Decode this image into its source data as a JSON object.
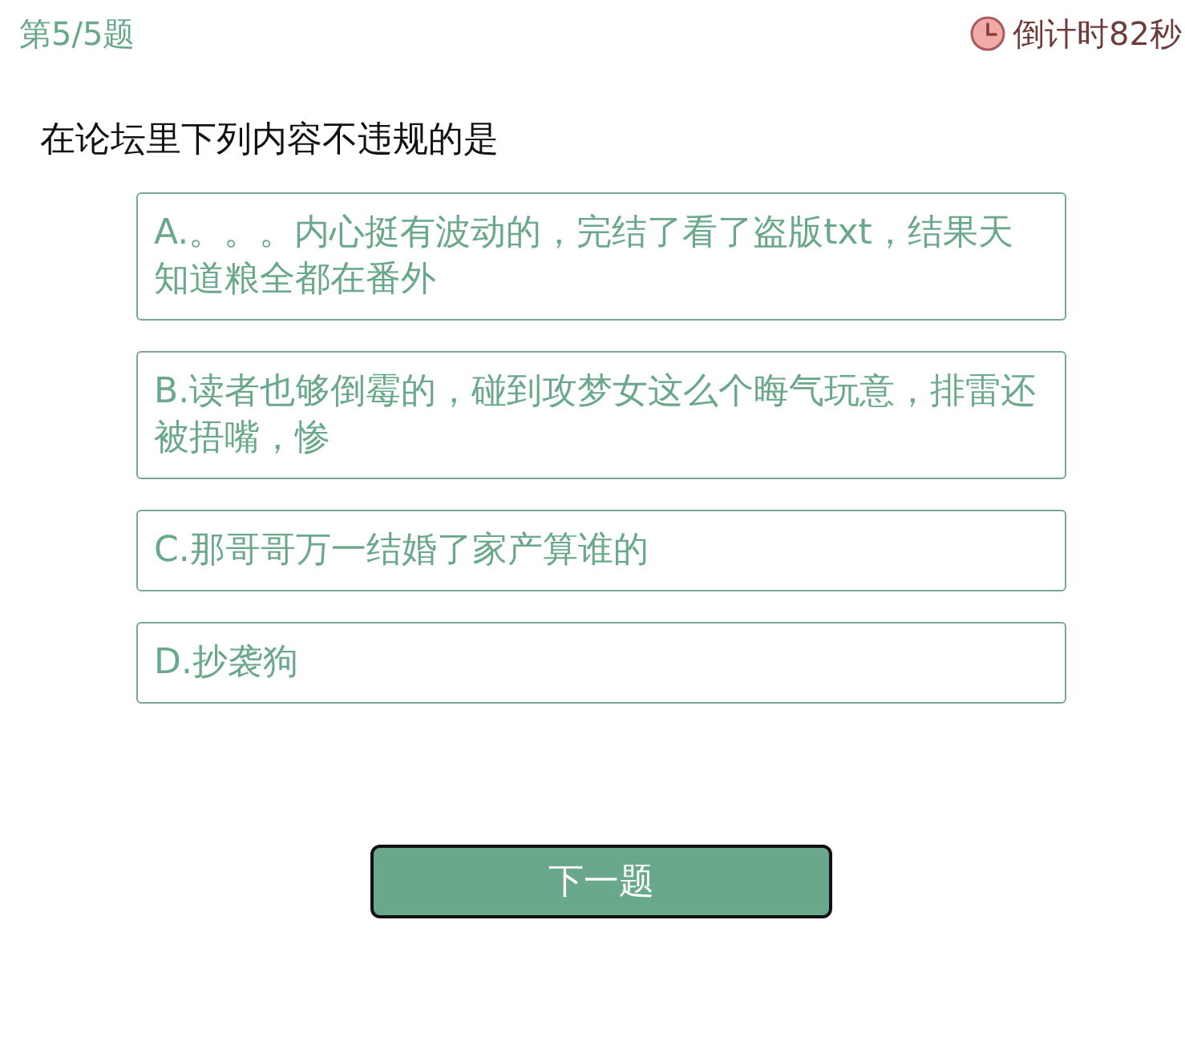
{
  "header": {
    "question_number": "第5/5题",
    "timer": "倒计时82秒"
  },
  "question": "在论坛里下列内容不违规的是",
  "options": [
    {
      "text": "A.。。。内心挺有波动的，完结了看了盗版txt，结果天知道粮全都在番外",
      "selected": false
    },
    {
      "text": "B.读者也够倒霉的，碰到攻梦女这么个晦气玩意，排雷还被捂嘴，惨",
      "selected": false
    },
    {
      "text": "C.那哥哥万一结婚了家产算谁的",
      "selected": false
    },
    {
      "text": "D.抄袭狗",
      "selected": false
    }
  ],
  "next_button": "下一题"
}
